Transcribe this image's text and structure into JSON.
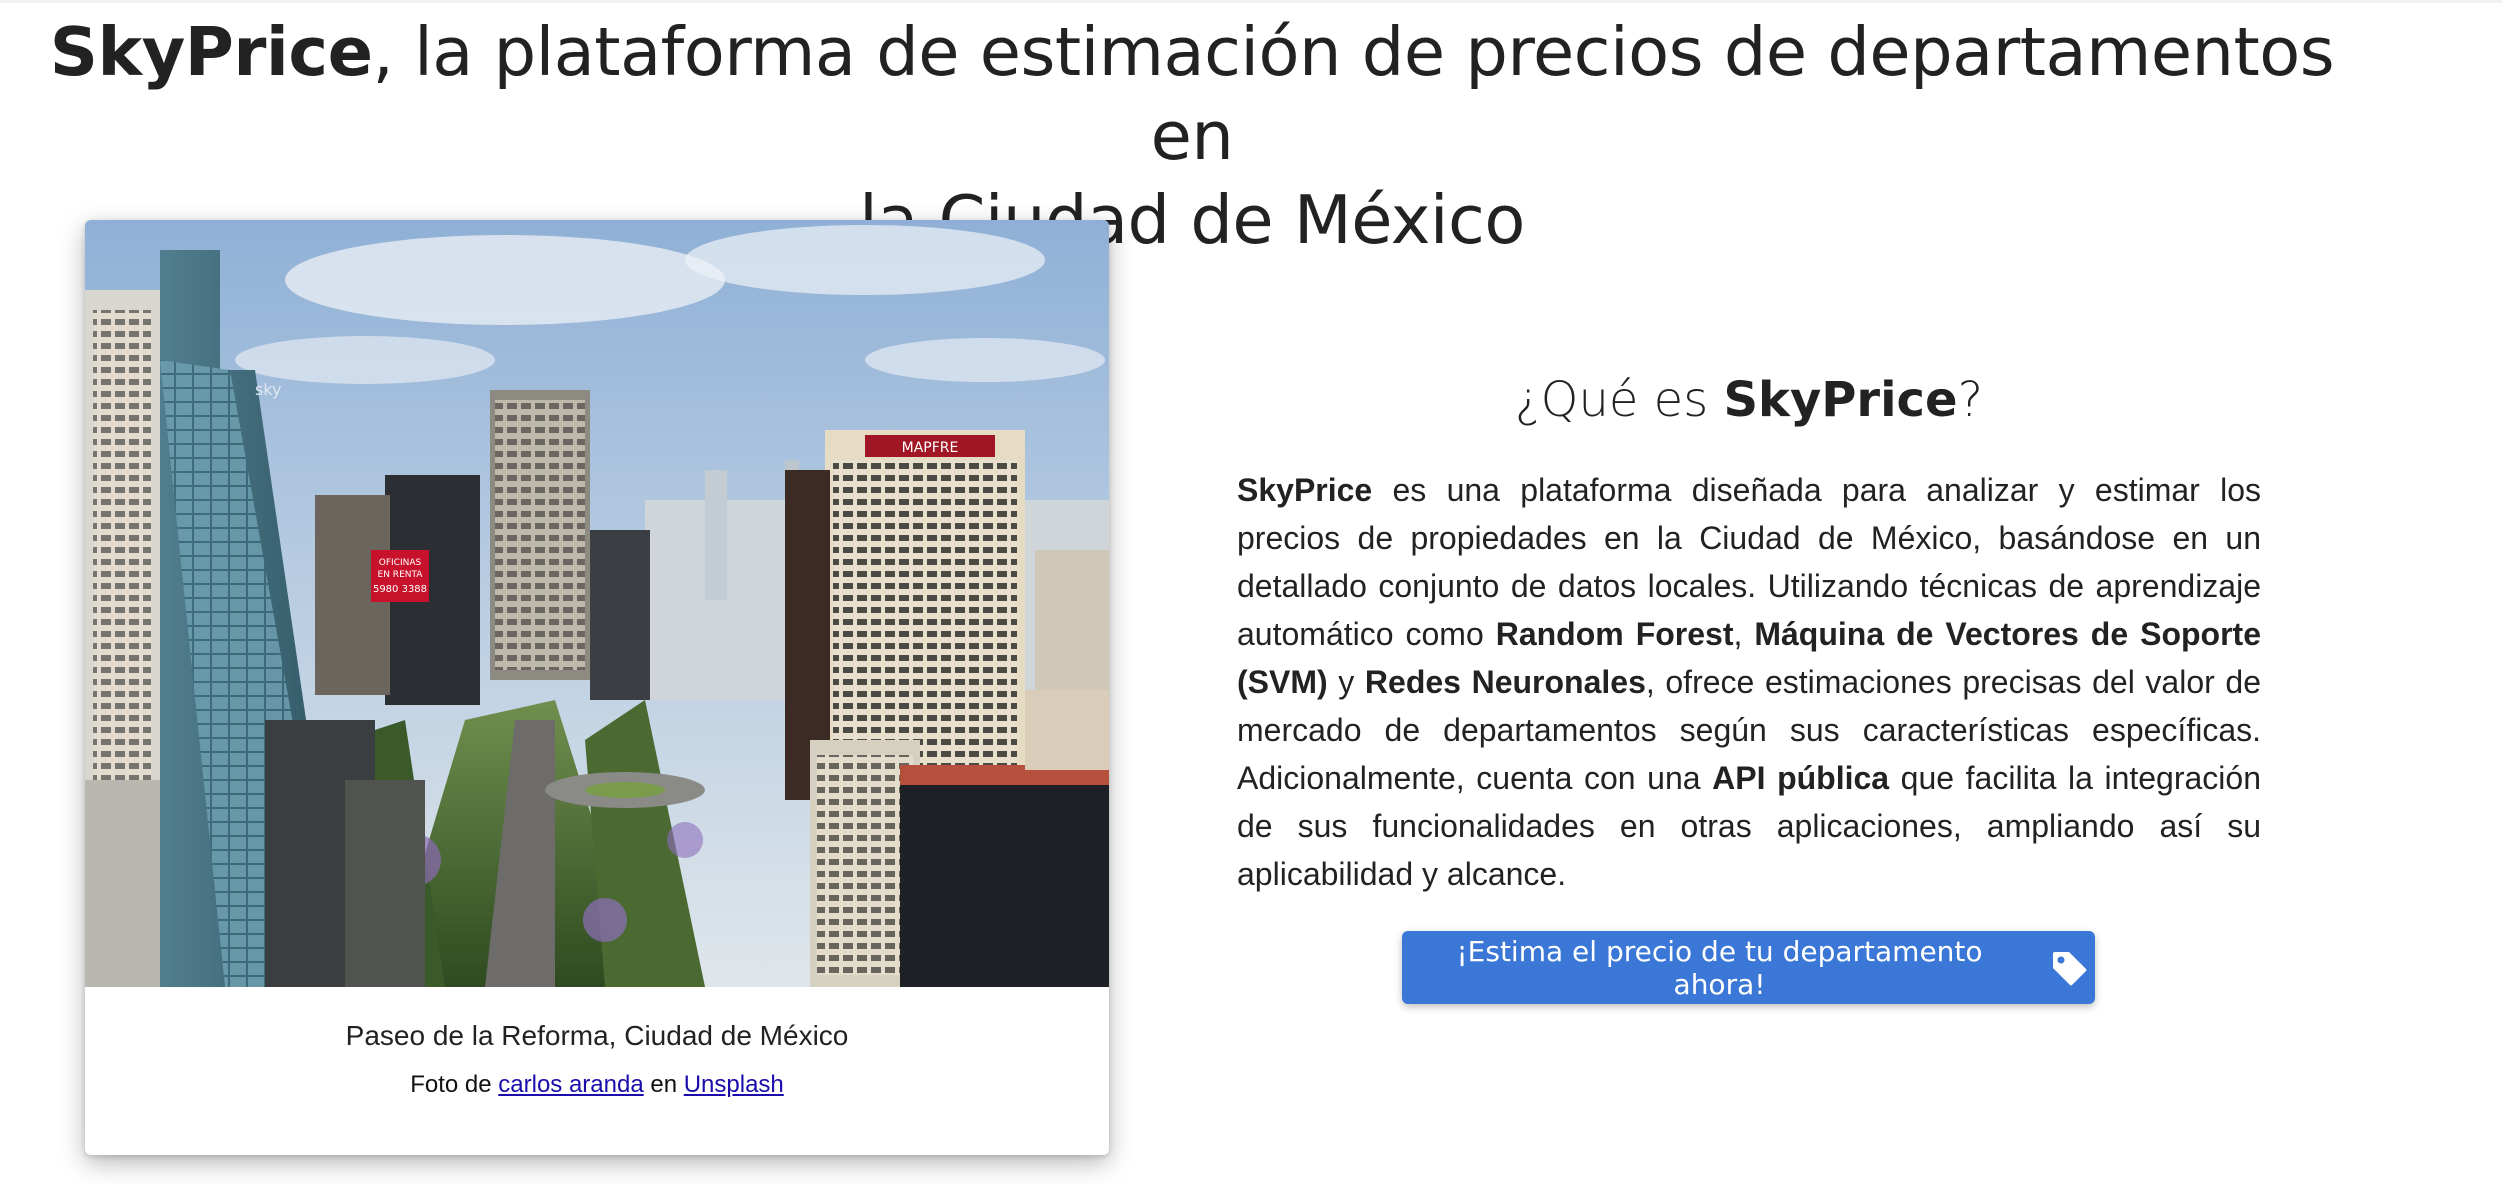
{
  "header": {
    "brand": "SkyPrice",
    "title_rest_line1": ", la plataforma de estimación de precios de departamentos en",
    "title_line2": "la Ciudad de México"
  },
  "photo": {
    "alt": "Paseo de la Reforma, Ciudad de México",
    "caption": "Paseo de la Reforma, Ciudad de México",
    "credit_prefix": "Foto de ",
    "author_link": "carlos aranda",
    "credit_middle": " en ",
    "source_link": "Unsplash",
    "billboard_line1": "OFICINAS",
    "billboard_line2": "EN RENTA",
    "billboard_line3": "5980 3388",
    "building_sign": "MAPFRE"
  },
  "about": {
    "heading_prefix": "¿Qué es ",
    "heading_brand": "SkyPrice",
    "heading_suffix": "?",
    "p_brand": "SkyPrice",
    "p1": " es una plataforma diseñada para analizar y estimar los precios de propiedades en la Ciudad de México, basándose en un detallado conjunto de datos locales. Utilizando técnicas de aprendizaje automático como ",
    "rf": "Random Forest",
    "sep1": ", ",
    "svm": "Máquina de Vectores de Soporte (SVM)",
    "sep2": " y ",
    "nn": "Redes Neuronales",
    "p2": ", ofrece estimaciones precisas del valor de mercado de departamentos según sus características específicas. Adicionalmente, cuenta con una ",
    "api": "API pública",
    "p3": " que facilita la integración de sus funcionalidades en otras aplicaciones, ampliando así su aplicabilidad y alcance."
  },
  "cta": {
    "label": "¡Estima el precio de tu departamento ahora!",
    "icon": "tag-icon"
  },
  "colors": {
    "button": "#3a77d6",
    "link": "#1a0dab",
    "text": "#222222"
  }
}
